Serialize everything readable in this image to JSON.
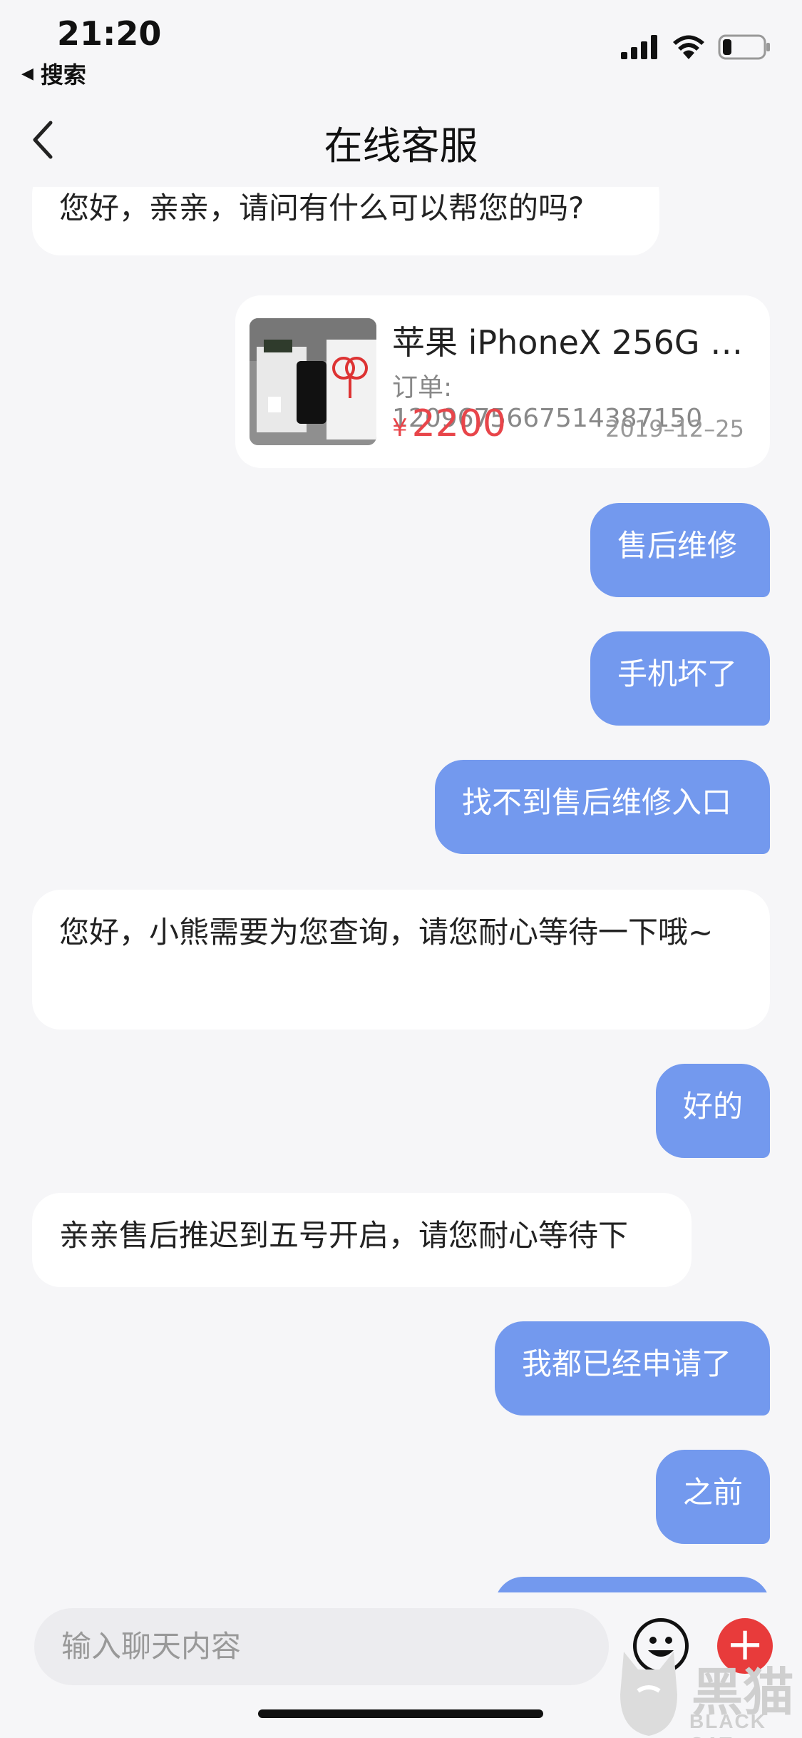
{
  "status_bar": {
    "time": "21:20",
    "back_app_label": "搜索",
    "icons": [
      "cellular-signal-icon",
      "wifi-icon",
      "battery-icon"
    ]
  },
  "nav": {
    "title": "在线客服",
    "back_icon": "chevron-left-icon"
  },
  "messages": [
    {
      "side": "in",
      "text": "您好，亲亲，请问有什么可以帮您的吗?"
    },
    {
      "side": "out",
      "text": "售后维修"
    },
    {
      "side": "out",
      "text": "手机坏了"
    },
    {
      "side": "out",
      "text": "找不到售后维修入口"
    },
    {
      "side": "in",
      "text": "您好，小熊需要为您查询，请您耐心等待一下哦~"
    },
    {
      "side": "out",
      "text": "好的"
    },
    {
      "side": "in",
      "text": "亲亲售后推迟到五号开启，请您耐心等待下"
    },
    {
      "side": "out",
      "text": "我都已经申请了"
    },
    {
      "side": "out",
      "text": "之前"
    }
  ],
  "product_card": {
    "name": "苹果 iPhoneX 256G …",
    "order_label": "订单: 1209675667514387150",
    "currency": "¥",
    "price": "2200",
    "date": "2019–12–25"
  },
  "input_bar": {
    "placeholder": "输入聊天内容",
    "emoji_icon": "smiley-face-icon",
    "plus_icon": "plus-icon"
  },
  "watermark": {
    "text_cn": "黑猫",
    "text_en": "BLACK CAT"
  },
  "colors": {
    "accent_bubble": "#7399ee",
    "price": "#e8454a",
    "plus_button": "#e83b3b"
  }
}
